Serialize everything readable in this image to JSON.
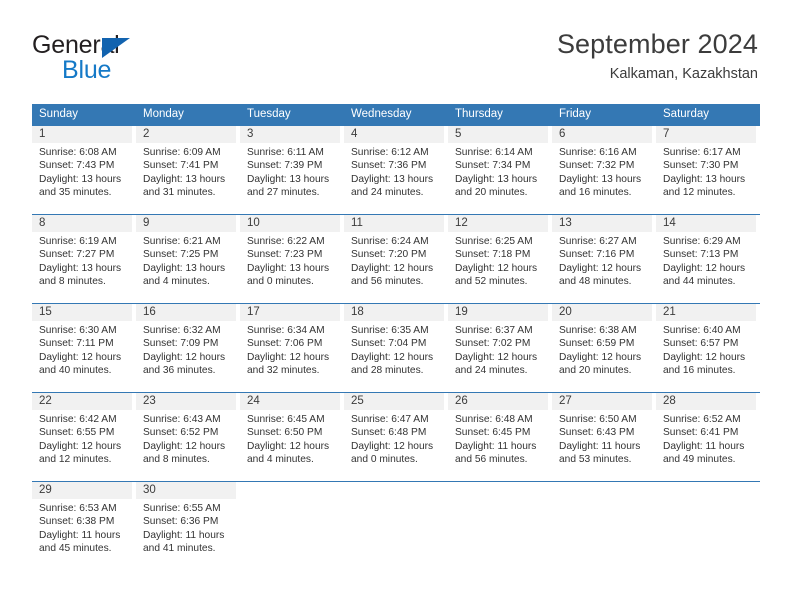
{
  "brand": {
    "name_top": "General",
    "name_bottom": "Blue",
    "triangle_color": "#1263af",
    "blue_color": "#1579c7"
  },
  "header": {
    "title": "September 2024",
    "location": "Kalkaman, Kazakhstan"
  },
  "theme": {
    "header_blue": "#3478b4",
    "daynum_bg": "#f1f1f1",
    "text": "#333333"
  },
  "calendar": {
    "day_headers": [
      "Sunday",
      "Monday",
      "Tuesday",
      "Wednesday",
      "Thursday",
      "Friday",
      "Saturday"
    ],
    "labels": {
      "sunrise": "Sunrise:",
      "sunset": "Sunset:",
      "daylight": "Daylight:"
    },
    "weeks": [
      [
        {
          "day": "1",
          "sunrise": "Sunrise: 6:08 AM",
          "sunset": "Sunset: 7:43 PM",
          "daylight_line1": "Daylight: 13 hours",
          "daylight_line2": "and 35 minutes."
        },
        {
          "day": "2",
          "sunrise": "Sunrise: 6:09 AM",
          "sunset": "Sunset: 7:41 PM",
          "daylight_line1": "Daylight: 13 hours",
          "daylight_line2": "and 31 minutes."
        },
        {
          "day": "3",
          "sunrise": "Sunrise: 6:11 AM",
          "sunset": "Sunset: 7:39 PM",
          "daylight_line1": "Daylight: 13 hours",
          "daylight_line2": "and 27 minutes."
        },
        {
          "day": "4",
          "sunrise": "Sunrise: 6:12 AM",
          "sunset": "Sunset: 7:36 PM",
          "daylight_line1": "Daylight: 13 hours",
          "daylight_line2": "and 24 minutes."
        },
        {
          "day": "5",
          "sunrise": "Sunrise: 6:14 AM",
          "sunset": "Sunset: 7:34 PM",
          "daylight_line1": "Daylight: 13 hours",
          "daylight_line2": "and 20 minutes."
        },
        {
          "day": "6",
          "sunrise": "Sunrise: 6:16 AM",
          "sunset": "Sunset: 7:32 PM",
          "daylight_line1": "Daylight: 13 hours",
          "daylight_line2": "and 16 minutes."
        },
        {
          "day": "7",
          "sunrise": "Sunrise: 6:17 AM",
          "sunset": "Sunset: 7:30 PM",
          "daylight_line1": "Daylight: 13 hours",
          "daylight_line2": "and 12 minutes."
        }
      ],
      [
        {
          "day": "8",
          "sunrise": "Sunrise: 6:19 AM",
          "sunset": "Sunset: 7:27 PM",
          "daylight_line1": "Daylight: 13 hours",
          "daylight_line2": "and 8 minutes."
        },
        {
          "day": "9",
          "sunrise": "Sunrise: 6:21 AM",
          "sunset": "Sunset: 7:25 PM",
          "daylight_line1": "Daylight: 13 hours",
          "daylight_line2": "and 4 minutes."
        },
        {
          "day": "10",
          "sunrise": "Sunrise: 6:22 AM",
          "sunset": "Sunset: 7:23 PM",
          "daylight_line1": "Daylight: 13 hours",
          "daylight_line2": "and 0 minutes."
        },
        {
          "day": "11",
          "sunrise": "Sunrise: 6:24 AM",
          "sunset": "Sunset: 7:20 PM",
          "daylight_line1": "Daylight: 12 hours",
          "daylight_line2": "and 56 minutes."
        },
        {
          "day": "12",
          "sunrise": "Sunrise: 6:25 AM",
          "sunset": "Sunset: 7:18 PM",
          "daylight_line1": "Daylight: 12 hours",
          "daylight_line2": "and 52 minutes."
        },
        {
          "day": "13",
          "sunrise": "Sunrise: 6:27 AM",
          "sunset": "Sunset: 7:16 PM",
          "daylight_line1": "Daylight: 12 hours",
          "daylight_line2": "and 48 minutes."
        },
        {
          "day": "14",
          "sunrise": "Sunrise: 6:29 AM",
          "sunset": "Sunset: 7:13 PM",
          "daylight_line1": "Daylight: 12 hours",
          "daylight_line2": "and 44 minutes."
        }
      ],
      [
        {
          "day": "15",
          "sunrise": "Sunrise: 6:30 AM",
          "sunset": "Sunset: 7:11 PM",
          "daylight_line1": "Daylight: 12 hours",
          "daylight_line2": "and 40 minutes."
        },
        {
          "day": "16",
          "sunrise": "Sunrise: 6:32 AM",
          "sunset": "Sunset: 7:09 PM",
          "daylight_line1": "Daylight: 12 hours",
          "daylight_line2": "and 36 minutes."
        },
        {
          "day": "17",
          "sunrise": "Sunrise: 6:34 AM",
          "sunset": "Sunset: 7:06 PM",
          "daylight_line1": "Daylight: 12 hours",
          "daylight_line2": "and 32 minutes."
        },
        {
          "day": "18",
          "sunrise": "Sunrise: 6:35 AM",
          "sunset": "Sunset: 7:04 PM",
          "daylight_line1": "Daylight: 12 hours",
          "daylight_line2": "and 28 minutes."
        },
        {
          "day": "19",
          "sunrise": "Sunrise: 6:37 AM",
          "sunset": "Sunset: 7:02 PM",
          "daylight_line1": "Daylight: 12 hours",
          "daylight_line2": "and 24 minutes."
        },
        {
          "day": "20",
          "sunrise": "Sunrise: 6:38 AM",
          "sunset": "Sunset: 6:59 PM",
          "daylight_line1": "Daylight: 12 hours",
          "daylight_line2": "and 20 minutes."
        },
        {
          "day": "21",
          "sunrise": "Sunrise: 6:40 AM",
          "sunset": "Sunset: 6:57 PM",
          "daylight_line1": "Daylight: 12 hours",
          "daylight_line2": "and 16 minutes."
        }
      ],
      [
        {
          "day": "22",
          "sunrise": "Sunrise: 6:42 AM",
          "sunset": "Sunset: 6:55 PM",
          "daylight_line1": "Daylight: 12 hours",
          "daylight_line2": "and 12 minutes."
        },
        {
          "day": "23",
          "sunrise": "Sunrise: 6:43 AM",
          "sunset": "Sunset: 6:52 PM",
          "daylight_line1": "Daylight: 12 hours",
          "daylight_line2": "and 8 minutes."
        },
        {
          "day": "24",
          "sunrise": "Sunrise: 6:45 AM",
          "sunset": "Sunset: 6:50 PM",
          "daylight_line1": "Daylight: 12 hours",
          "daylight_line2": "and 4 minutes."
        },
        {
          "day": "25",
          "sunrise": "Sunrise: 6:47 AM",
          "sunset": "Sunset: 6:48 PM",
          "daylight_line1": "Daylight: 12 hours",
          "daylight_line2": "and 0 minutes."
        },
        {
          "day": "26",
          "sunrise": "Sunrise: 6:48 AM",
          "sunset": "Sunset: 6:45 PM",
          "daylight_line1": "Daylight: 11 hours",
          "daylight_line2": "and 56 minutes."
        },
        {
          "day": "27",
          "sunrise": "Sunrise: 6:50 AM",
          "sunset": "Sunset: 6:43 PM",
          "daylight_line1": "Daylight: 11 hours",
          "daylight_line2": "and 53 minutes."
        },
        {
          "day": "28",
          "sunrise": "Sunrise: 6:52 AM",
          "sunset": "Sunset: 6:41 PM",
          "daylight_line1": "Daylight: 11 hours",
          "daylight_line2": "and 49 minutes."
        }
      ],
      [
        {
          "day": "29",
          "sunrise": "Sunrise: 6:53 AM",
          "sunset": "Sunset: 6:38 PM",
          "daylight_line1": "Daylight: 11 hours",
          "daylight_line2": "and 45 minutes."
        },
        {
          "day": "30",
          "sunrise": "Sunrise: 6:55 AM",
          "sunset": "Sunset: 6:36 PM",
          "daylight_line1": "Daylight: 11 hours",
          "daylight_line2": "and 41 minutes."
        },
        {
          "day": "",
          "sunrise": "",
          "sunset": "",
          "daylight_line1": "",
          "daylight_line2": ""
        },
        {
          "day": "",
          "sunrise": "",
          "sunset": "",
          "daylight_line1": "",
          "daylight_line2": ""
        },
        {
          "day": "",
          "sunrise": "",
          "sunset": "",
          "daylight_line1": "",
          "daylight_line2": ""
        },
        {
          "day": "",
          "sunrise": "",
          "sunset": "",
          "daylight_line1": "",
          "daylight_line2": ""
        },
        {
          "day": "",
          "sunrise": "",
          "sunset": "",
          "daylight_line1": "",
          "daylight_line2": ""
        }
      ]
    ]
  }
}
